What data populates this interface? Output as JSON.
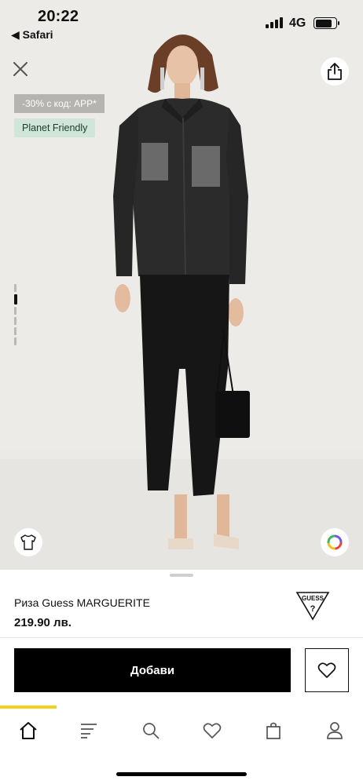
{
  "status_bar": {
    "time": "20:22",
    "back_app": "◀ Safari",
    "network": "4G"
  },
  "badges": {
    "sale": "-30% с код: APP*",
    "eco": "Planet Friendly"
  },
  "product": {
    "name": "Риза Guess MARGUERITE",
    "price": "219.90 лв.",
    "brand_logo_text": "GUESS"
  },
  "actions": {
    "add_label": "Добави"
  },
  "gallery": {
    "image_count": 6,
    "active_index": 1
  },
  "tabs": [
    "home",
    "catalog",
    "search",
    "wishlist",
    "bag",
    "account"
  ],
  "colors": {
    "accent_yellow": "#f2d21a",
    "button": "#000000",
    "eco_badge": "#cfe6d9",
    "sale_badge": "#b5b4b1"
  },
  "icons": [
    "close-icon",
    "share-icon",
    "tshirt-icon",
    "color-wheel-icon",
    "heart-icon",
    "home-icon",
    "menu-icon",
    "search-icon",
    "bag-icon",
    "user-icon"
  ]
}
